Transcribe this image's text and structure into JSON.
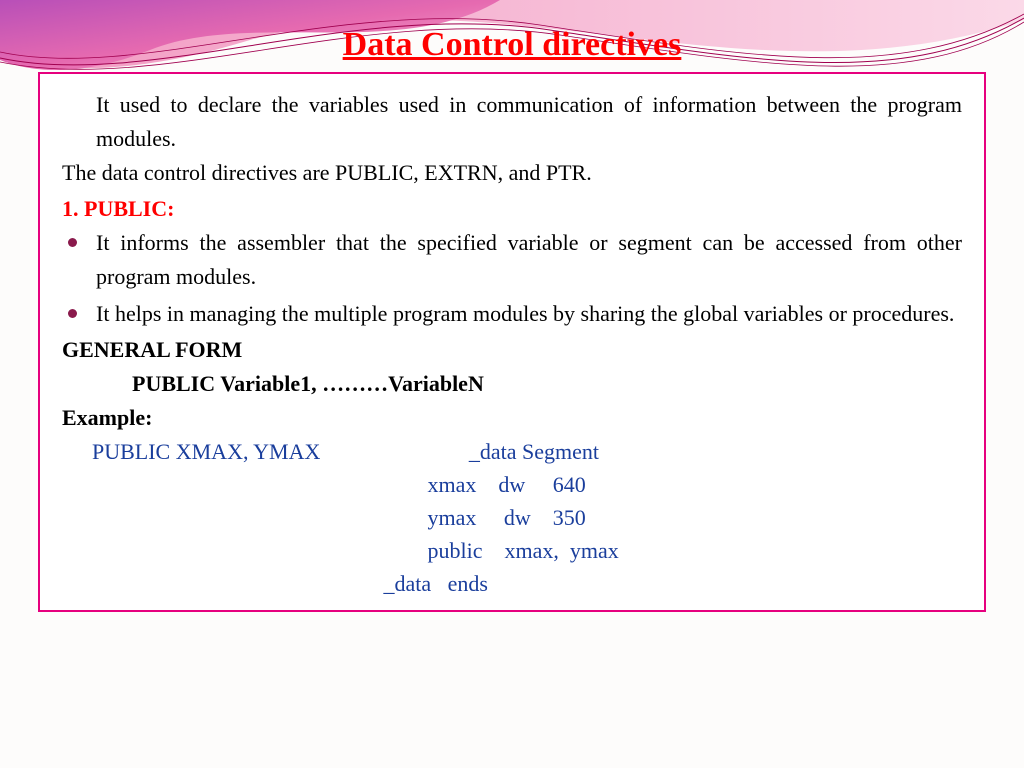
{
  "title": "Data Control directives",
  "intro": "It used to declare the variables used in communication of information between the program modules.",
  "directives_line": "The data control directives are PUBLIC, EXTRN, and PTR.",
  "section1_heading": "1. PUBLIC:",
  "bullets": [
    "It informs the assembler that the specified variable or segment can be accessed from other program modules.",
    "It helps in managing the multiple program modules by sharing the global variables or procedures."
  ],
  "general_form_label": "GENERAL   FORM",
  "general_form_syntax": "PUBLIC      Variable1, ………VariableN",
  "example_label": "Example:",
  "example_code": "PUBLIC XMAX, YMAX                           _data Segment\n                                                             xmax    dw     640\n                                                             ymax     dw    350\n                                                             public    xmax,  ymax\n                                                     _data   ends"
}
